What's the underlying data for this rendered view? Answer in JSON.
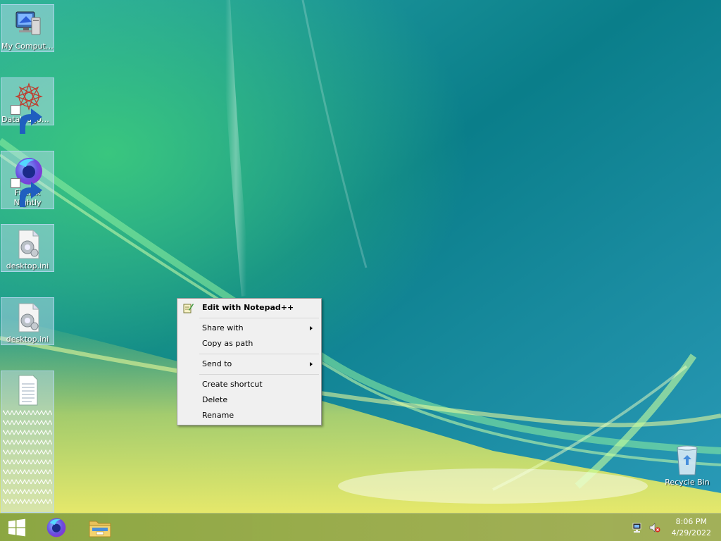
{
  "desktop": {
    "icons": [
      {
        "label": "My Computer",
        "icon": "computer-icon"
      },
      {
        "label": "DataWagon...",
        "icon": "datawagon-icon",
        "shortcut": true
      },
      {
        "label": "Firefox Nightly",
        "icon": "firefox-nightly-icon",
        "shortcut": true
      },
      {
        "label": "desktop.ini",
        "icon": "settings-file-icon"
      },
      {
        "label": "desktop.ini",
        "icon": "settings-file-icon"
      },
      {
        "label": "",
        "icon": "text-file-icon"
      }
    ],
    "recycle_bin": {
      "label": "Recycle Bin",
      "icon": "recycle-bin-icon"
    }
  },
  "context_menu": {
    "items": [
      {
        "label": "Edit with Notepad++",
        "bold": true,
        "icon": "notepadpp-icon"
      },
      {
        "label": "Share with",
        "submenu": true
      },
      {
        "label": "Copy as path"
      },
      {
        "label": "Send to",
        "submenu": true
      },
      {
        "label": "Create shortcut"
      },
      {
        "label": "Delete"
      },
      {
        "label": "Rename"
      }
    ]
  },
  "taskbar": {
    "start_icon": "windows-logo-icon",
    "pinned": [
      {
        "name": "Firefox Nightly",
        "icon": "firefox-nightly-icon"
      },
      {
        "name": "File Explorer",
        "icon": "file-explorer-icon"
      }
    ],
    "tray": {
      "icons": [
        "network-icon",
        "volume-muted-icon"
      ],
      "time": "8:06 PM",
      "date": "4/29/2022"
    }
  },
  "colors": {
    "menu_bg": "#f0f0f0",
    "menu_border": "#979797",
    "taskbar": "#a3ad4a"
  }
}
